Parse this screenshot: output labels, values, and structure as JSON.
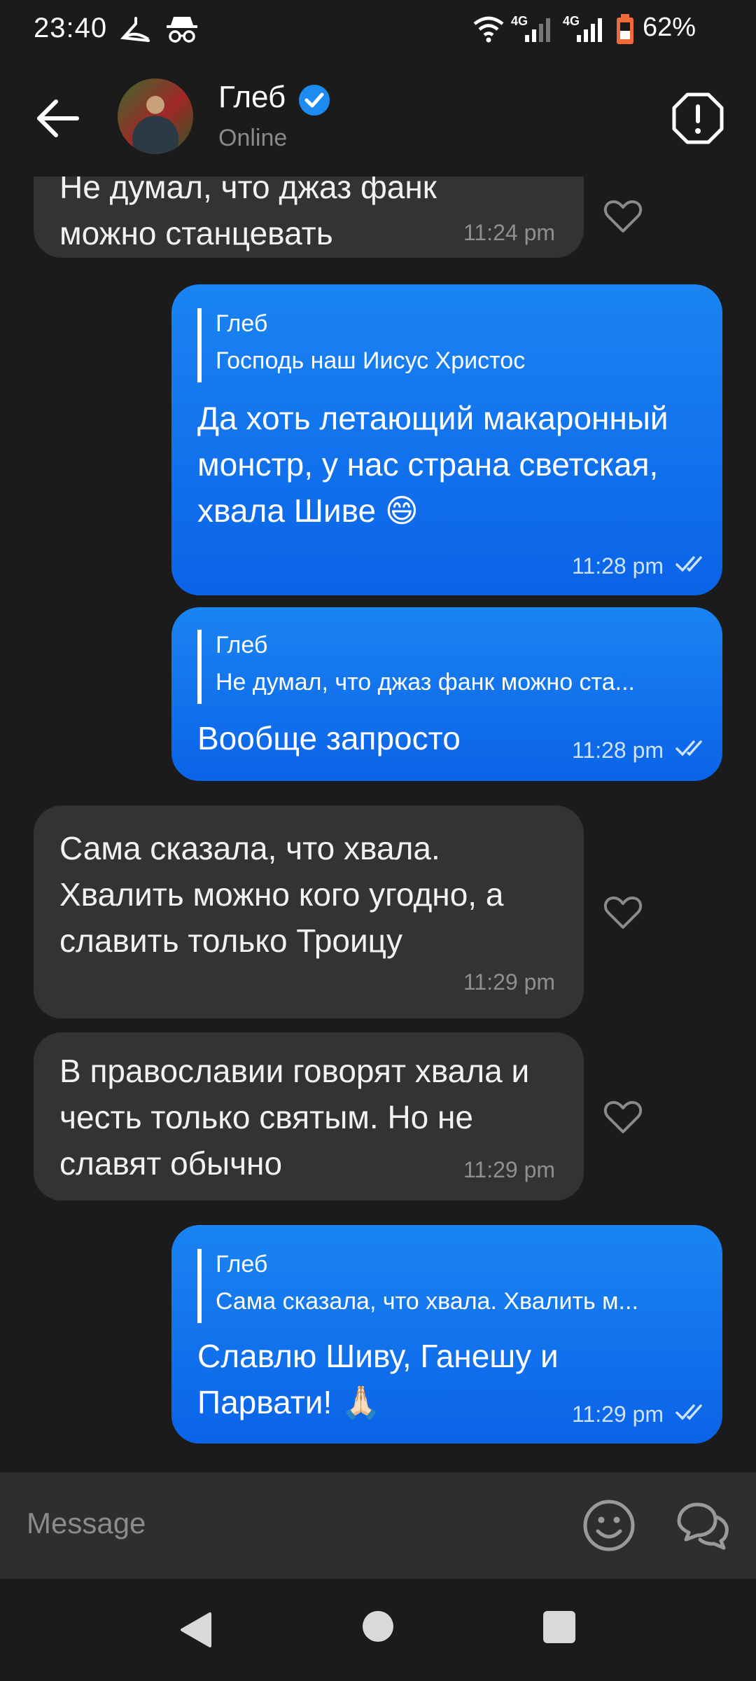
{
  "status_bar": {
    "time": "23:40",
    "net_label_1": "4G",
    "net_label_2": "4G",
    "battery": "62%",
    "icons": [
      "hanger-icon",
      "incognito-icon",
      "wifi-icon",
      "signal-icon",
      "signal-icon",
      "battery-icon"
    ]
  },
  "header": {
    "contact_name": "Глеб",
    "status": "Online",
    "verified": true
  },
  "messages": [
    {
      "direction": "in",
      "text_lines": [
        "Не думал, что джаз фанк",
        "можно станцевать"
      ],
      "time": "11:24 pm",
      "liked": false
    },
    {
      "direction": "out",
      "quote_name": "Глеб",
      "quote_text": "Господь наш Иисус Христос",
      "text": "Да хоть летающий макаронный монстр, у нас страна светская, хвала Шиве 😄",
      "time": "11:28 pm",
      "read": true
    },
    {
      "direction": "out",
      "quote_name": "Глеб",
      "quote_text": "Не думал, что джаз фанк можно ста...",
      "text": "Вообще запросто",
      "time": "11:28 pm",
      "read": true
    },
    {
      "direction": "in",
      "text": "Сама сказала, что хвала. Хвалить можно кого угодно, а славить только Троицу",
      "time": "11:29 pm",
      "liked": false
    },
    {
      "direction": "in",
      "text": "В православии говорят хвала и честь только святым. Но не славят обычно",
      "time": "11:29 pm",
      "liked": false
    },
    {
      "direction": "out",
      "quote_name": "Глеб",
      "quote_text": "Сама сказала, что хвала. Хвалить м...",
      "text": "Славлю Шиву, Ганешу и Парвати! 🙏🏻",
      "time": "11:29 pm",
      "read": true
    }
  ],
  "composer": {
    "placeholder": "Message"
  },
  "colors": {
    "background": "#1b1b1b",
    "incoming_bubble": "#333333",
    "outgoing_bubble": "#0b6cf0",
    "verified_badge": "#1d8cf2"
  }
}
